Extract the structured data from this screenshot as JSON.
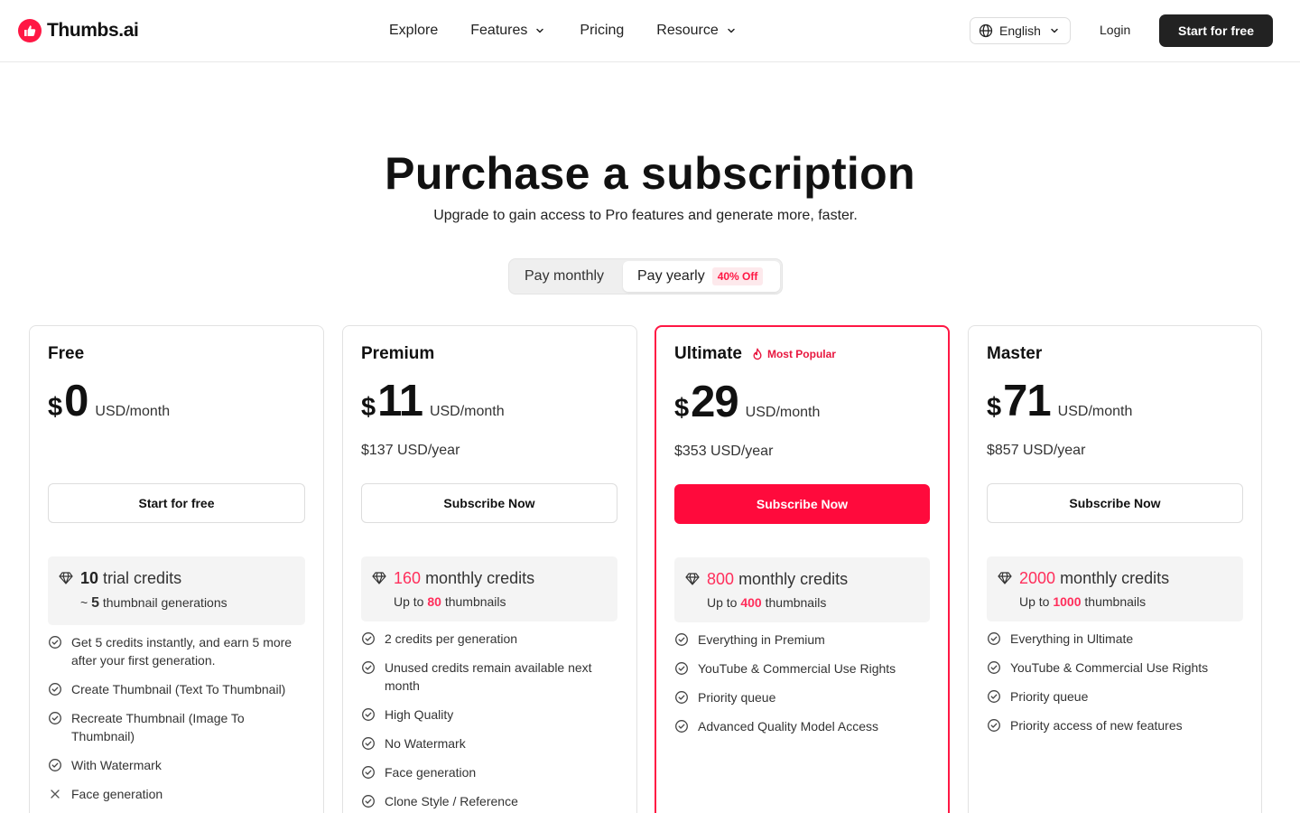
{
  "nav": {
    "brand": "Thumbs.ai",
    "links": [
      "Explore",
      "Features",
      "Pricing",
      "Resource"
    ],
    "language": "English",
    "login": "Login",
    "start": "Start for free"
  },
  "hero": {
    "title": "Purchase a subscription",
    "subtitle": "Upgrade to gain access to Pro features and generate more, faster."
  },
  "billing": {
    "monthly": "Pay monthly",
    "yearly": "Pay yearly",
    "discount": "40% Off",
    "selected": "yearly"
  },
  "colors": {
    "accent": "#ff0a3c",
    "dark_button": "#222222",
    "credit_box": "#f4f4f4"
  },
  "plans": [
    {
      "name": "Free",
      "currency": "$",
      "price": "0",
      "unit": "USD/month",
      "yearly": "",
      "cta": "Start for free",
      "credits_num": "10",
      "credits_label": "trial credits",
      "sub_prefix": "~",
      "sub_num": "5",
      "sub_label": "thumbnail generations",
      "features": [
        {
          "text": "Get 5 credits instantly, and earn 5 more after your first generation.",
          "included": true
        },
        {
          "text": "Create Thumbnail (Text To Thumbnail)",
          "included": true
        },
        {
          "text": "Recreate Thumbnail (Image To Thumbnail)",
          "included": true
        },
        {
          "text": "With Watermark",
          "included": true
        },
        {
          "text": "Face generation",
          "included": false
        }
      ]
    },
    {
      "name": "Premium",
      "currency": "$",
      "price": "11",
      "unit": "USD/month",
      "yearly": "$137 USD/year",
      "cta": "Subscribe Now",
      "credits_num": "160",
      "credits_label": "monthly credits",
      "sub_prefix": "Up to",
      "sub_num": "80",
      "sub_label": "thumbnails",
      "features": [
        {
          "text": "2 credits per generation",
          "included": true
        },
        {
          "text": "Unused credits remain available next month",
          "included": true
        },
        {
          "text": "High Quality",
          "included": true
        },
        {
          "text": "No Watermark",
          "included": true
        },
        {
          "text": "Face generation",
          "included": true
        },
        {
          "text": "Clone Style / Reference",
          "included": true
        }
      ]
    },
    {
      "name": "Ultimate",
      "badge": "Most Popular",
      "currency": "$",
      "price": "29",
      "unit": "USD/month",
      "yearly": "$353 USD/year",
      "cta": "Subscribe Now",
      "credits_num": "800",
      "credits_label": "monthly credits",
      "sub_prefix": "Up to",
      "sub_num": "400",
      "sub_label": "thumbnails",
      "features": [
        {
          "text": "Everything in Premium",
          "included": true
        },
        {
          "text": "YouTube & Commercial Use Rights",
          "included": true
        },
        {
          "text": "Priority queue",
          "included": true
        },
        {
          "text": "Advanced Quality Model Access",
          "included": true
        }
      ]
    },
    {
      "name": "Master",
      "currency": "$",
      "price": "71",
      "unit": "USD/month",
      "yearly": "$857 USD/year",
      "cta": "Subscribe Now",
      "credits_num": "2000",
      "credits_label": "monthly credits",
      "sub_prefix": "Up to",
      "sub_num": "1000",
      "sub_label": "thumbnails",
      "features": [
        {
          "text": "Everything in Ultimate",
          "included": true
        },
        {
          "text": "YouTube & Commercial Use Rights",
          "included": true
        },
        {
          "text": "Priority queue",
          "included": true
        },
        {
          "text": "Priority access of new features",
          "included": true
        }
      ]
    }
  ]
}
